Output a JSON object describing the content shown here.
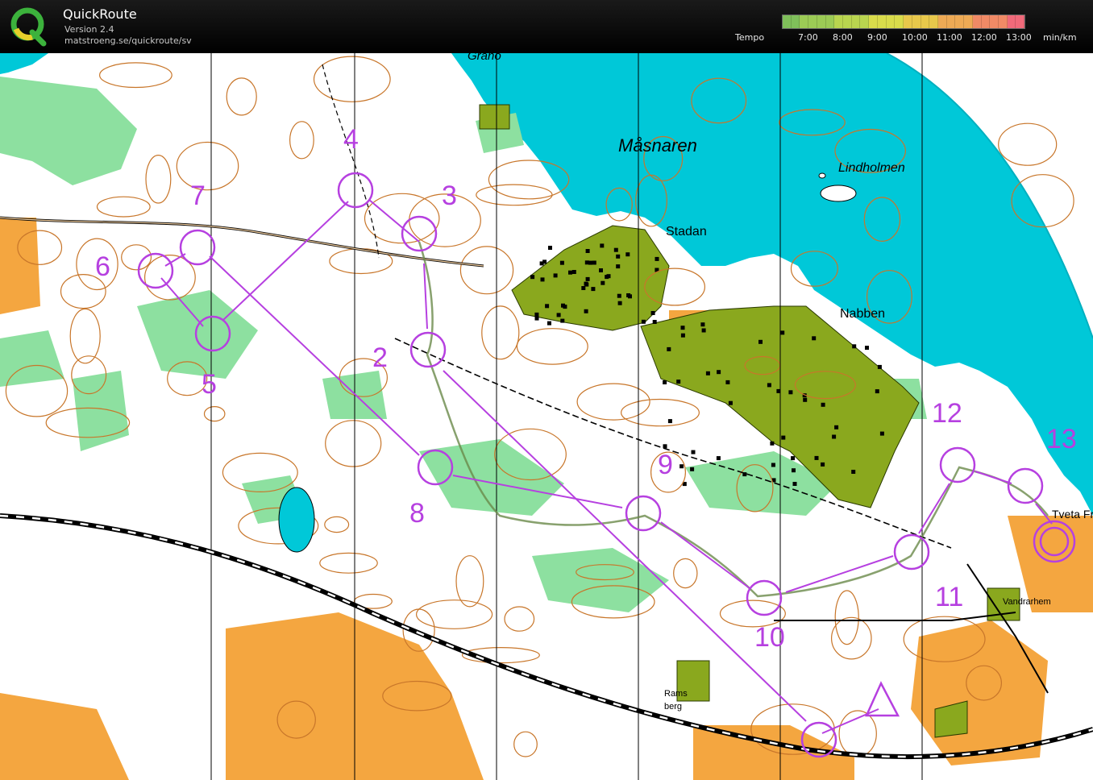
{
  "app": {
    "title": "QuickRoute",
    "version": "Version 2.4",
    "url": "matstroeng.se/quickroute/sv"
  },
  "legend": {
    "label": "Tempo",
    "ticks": [
      "7:00",
      "8:00",
      "9:00",
      "10:00",
      "11:00",
      "12:00",
      "13:00"
    ],
    "unit": "min/km",
    "gradient_colors": [
      "#7fbf5a",
      "#9ccb55",
      "#b9d54f",
      "#d9dc4b",
      "#e8c84b",
      "#eeaa55",
      "#f08a66",
      "#f06a7a"
    ]
  },
  "colors": {
    "water": "#00c8d8",
    "settlement": "#8aa81e",
    "open_land": "#f4a640",
    "green_vegetation": "#8de0a0",
    "course": "#b640e0",
    "contour": "#c8762a"
  },
  "map": {
    "places": {
      "grano": "Granö",
      "masnaren": "Måsnaren",
      "lindholmen": "Lindholmen",
      "stadan": "Stadan",
      "nabben": "Nabben",
      "tvetafril": "Tveta Fril",
      "vandrarhem": "Vandrarhem",
      "ramsberg_1": "Rams",
      "ramsberg_2": "berg"
    },
    "controls": [
      {
        "label": "2"
      },
      {
        "label": "3"
      },
      {
        "label": "4"
      },
      {
        "label": "5"
      },
      {
        "label": "6"
      },
      {
        "label": "7"
      },
      {
        "label": "8"
      },
      {
        "label": "9"
      },
      {
        "label": "10"
      },
      {
        "label": "11"
      },
      {
        "label": "12"
      },
      {
        "label": "13"
      }
    ]
  }
}
